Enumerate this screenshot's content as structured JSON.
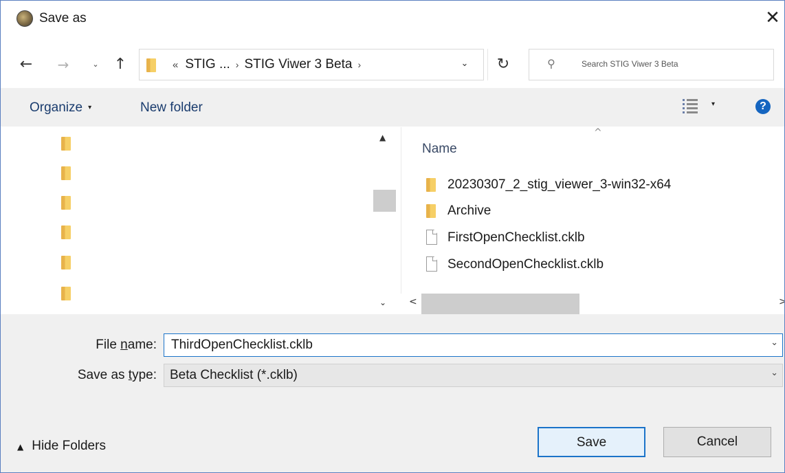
{
  "window": {
    "title": "Save as",
    "close_glyph": "✕"
  },
  "nav": {
    "back_glyph": "←",
    "forward_glyph": "→",
    "recent_glyph": "⌄",
    "up_glyph": "↑",
    "address": {
      "overflow": "«",
      "crumbs": [
        "STIG ...",
        "STIG Viwer 3 Beta"
      ],
      "separator": "›",
      "dropdown_glyph": "⌄"
    },
    "refresh_glyph": "↻",
    "search_placeholder": "Search STIG Viwer 3 Beta",
    "search_icon": "search-icon"
  },
  "toolbar": {
    "organize_label": "Organize",
    "organize_caret": "▾",
    "new_folder_label": "New folder",
    "view_icon": "view-options-icon",
    "view_caret": "▾",
    "help_label": "?"
  },
  "nav_pane": {
    "folder_count": 6,
    "scroll_up": "▲",
    "scroll_down": "⌄"
  },
  "file_list": {
    "sort_indicator": "^",
    "column_name": "Name",
    "items": [
      {
        "name": "20230307_2_stig_viewer_3-win32-x64",
        "type": "folder"
      },
      {
        "name": "Archive",
        "type": "folder"
      },
      {
        "name": "FirstOpenChecklist.cklb",
        "type": "file"
      },
      {
        "name": "SecondOpenChecklist.cklb",
        "type": "file"
      }
    ],
    "hscroll_left": "<",
    "hscroll_right": ">"
  },
  "form": {
    "file_name_label_pre": "File ",
    "file_name_label_u": "n",
    "file_name_label_post": "ame:",
    "file_name_value": "ThirdOpenChecklist.cklb",
    "save_type_label_pre": "Save as ",
    "save_type_label_u": "t",
    "save_type_label_post": "ype:",
    "save_type_value": "Beta Checklist (*.cklb)",
    "dropdown_glyph": "⌄"
  },
  "footer": {
    "hide_folders_caret": "▲",
    "hide_folders_label": "Hide Folders",
    "save_label": "Save",
    "cancel_label": "Cancel"
  },
  "colors": {
    "accent": "#1a73c9",
    "help": "#1565c0",
    "folder": "#f6cf66",
    "chrome": "#f0f0f0"
  }
}
